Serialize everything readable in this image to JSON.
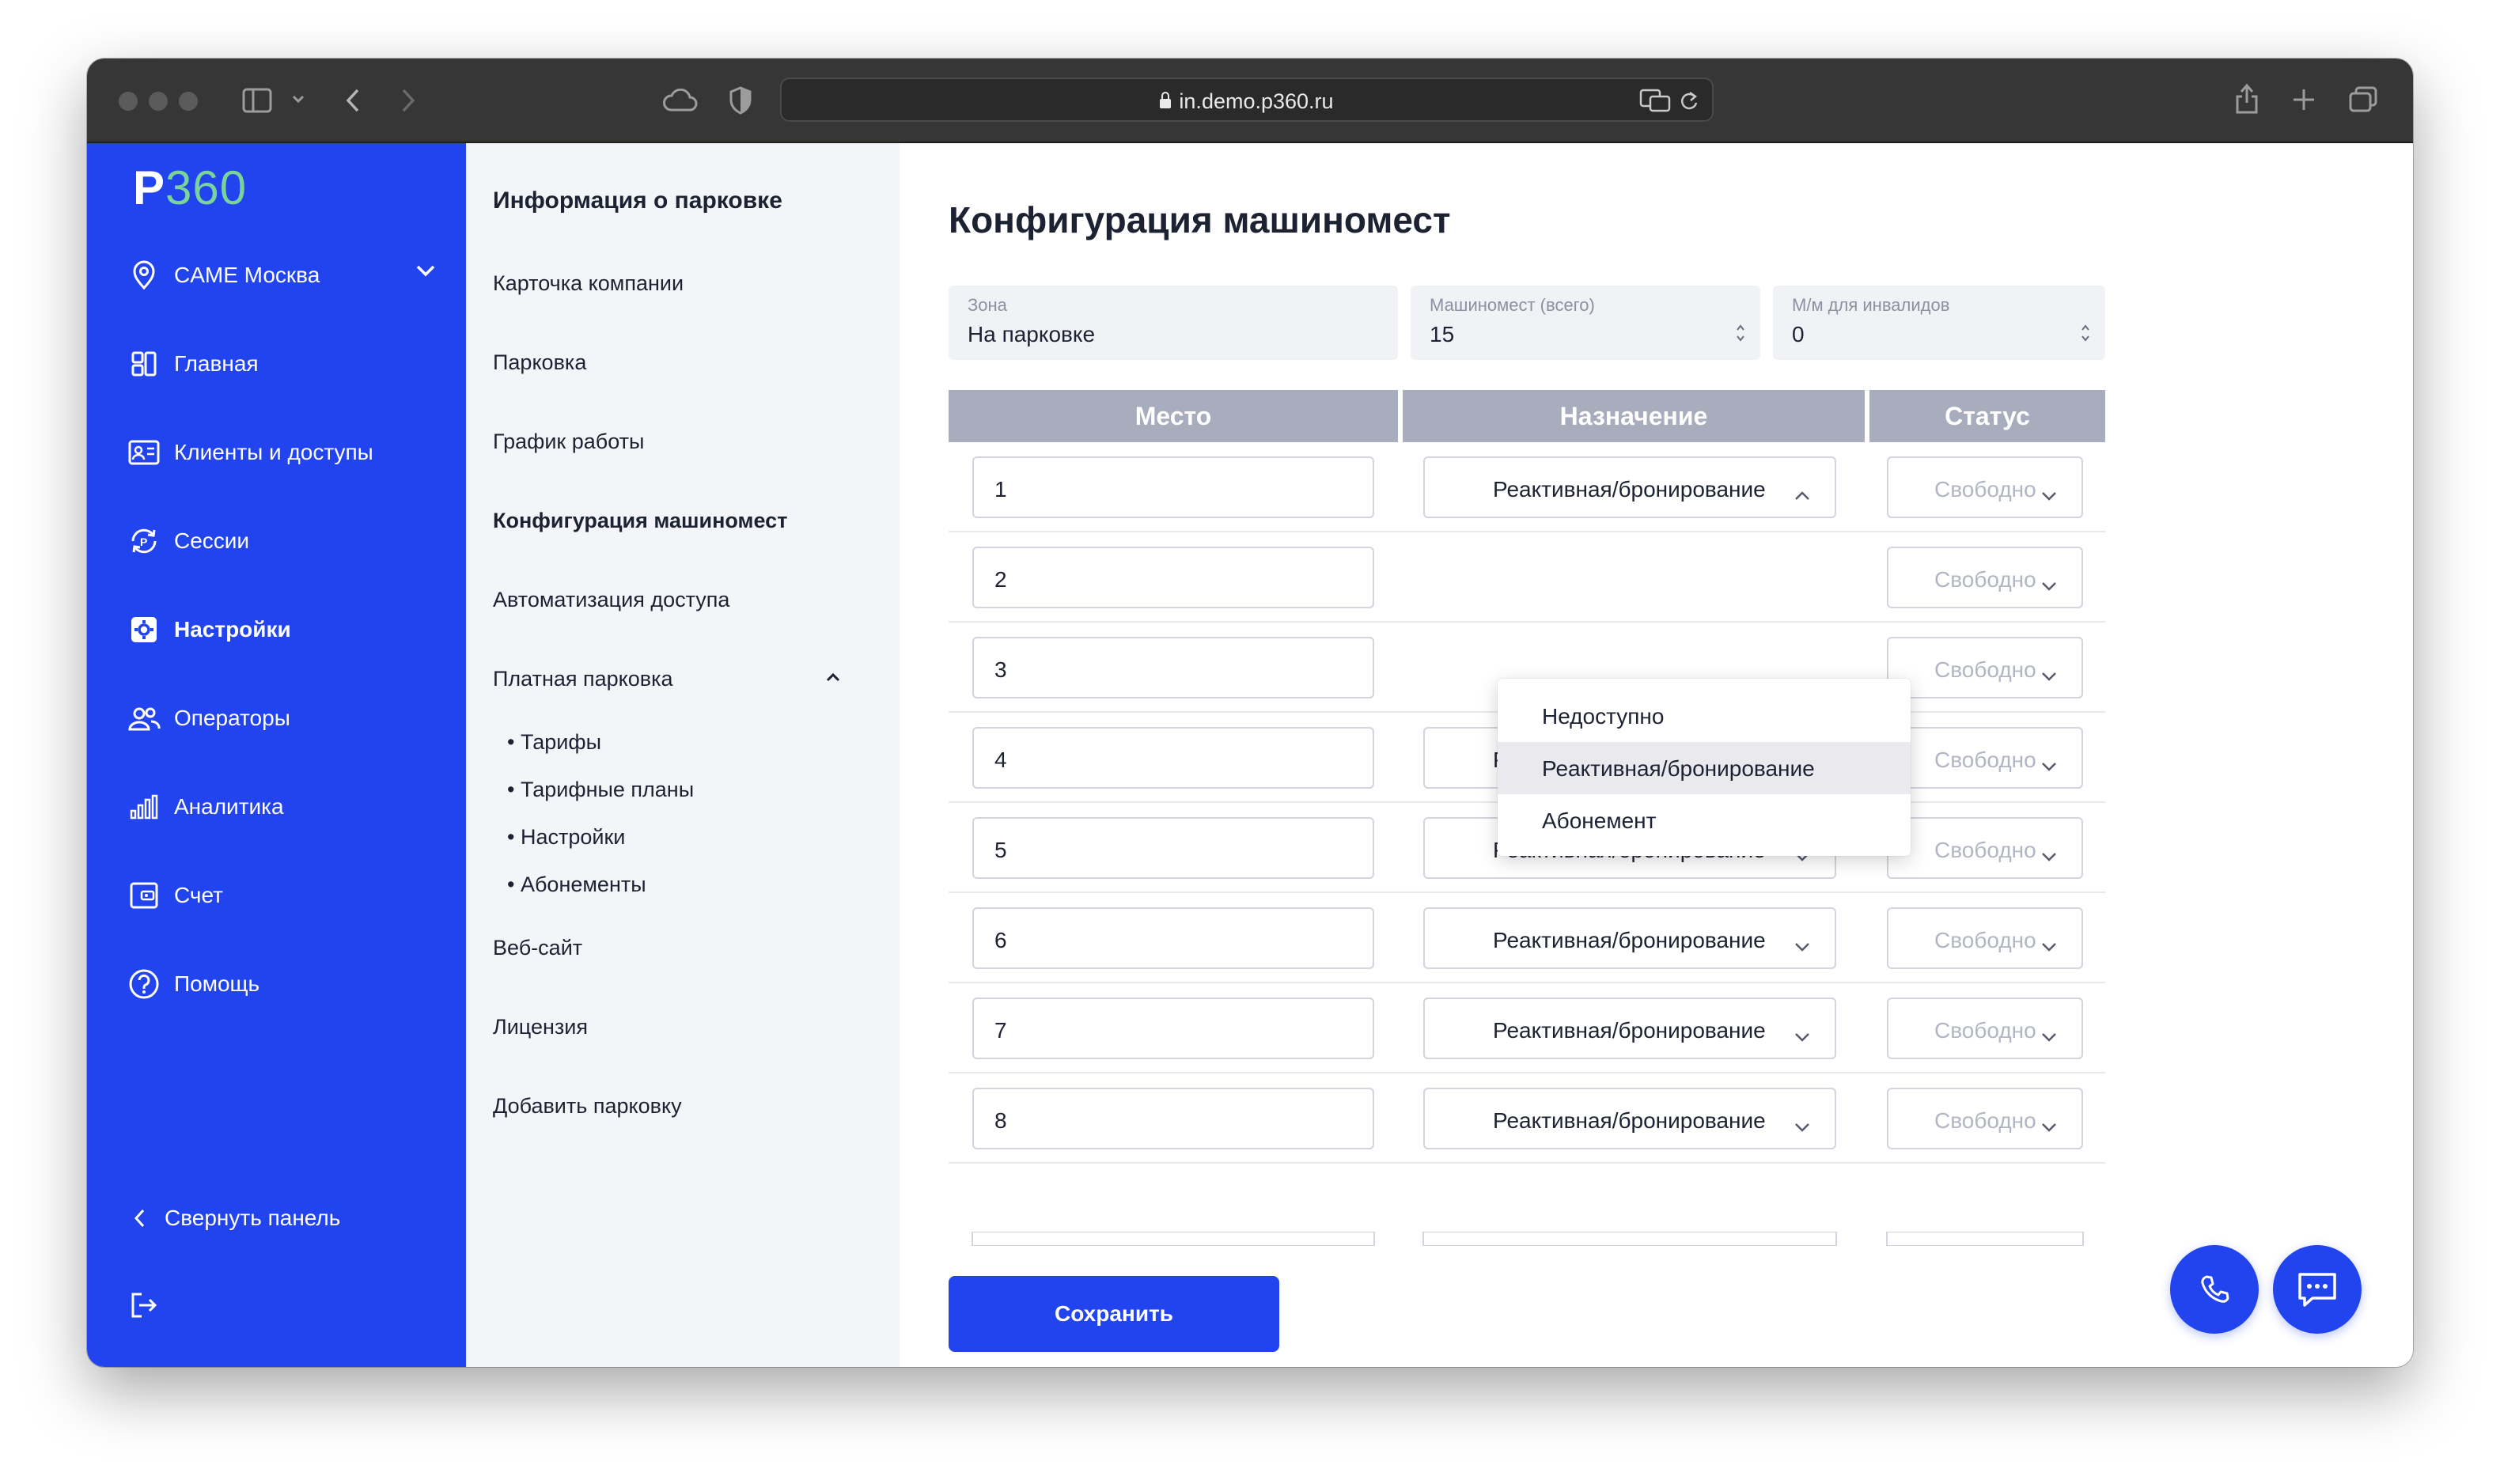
{
  "browser": {
    "url": "in.demo.p360.ru"
  },
  "sidebar": {
    "logo_p": "P",
    "logo_n": "360",
    "org": "CAME Москва",
    "items": [
      {
        "label": "Главная"
      },
      {
        "label": "Клиенты и доступы"
      },
      {
        "label": "Сессии"
      },
      {
        "label": "Настройки"
      },
      {
        "label": "Операторы"
      },
      {
        "label": "Аналитика"
      },
      {
        "label": "Счет"
      },
      {
        "label": "Помощь"
      }
    ],
    "collapse": "Свернуть панель"
  },
  "settings": {
    "title": "Информация о парковке",
    "items": [
      "Карточка компании",
      "Парковка",
      "График работы",
      "Конфигурация машиномест",
      "Автоматизация доступа",
      "Платная парковка",
      "Веб-сайт",
      "Лицензия",
      "Добавить парковку"
    ],
    "paid_sub": [
      "• Тарифы",
      "• Тарифные планы",
      "• Настройки",
      "• Абонементы"
    ]
  },
  "main": {
    "title": "Конфигурация машиномест",
    "fields": {
      "zone_label": "Зона",
      "zone_value": "На парковке",
      "total_label": "Машиномест (всего)",
      "total_value": "15",
      "disabled_label": "М/м для инвалидов",
      "disabled_value": "0"
    },
    "columns": [
      "Место",
      "Назначение",
      "Статус"
    ],
    "rows": [
      {
        "place": "1",
        "purpose": "Реактивная/бронирование",
        "status": "Свободно"
      },
      {
        "place": "2",
        "purpose": "",
        "status": "Свободно"
      },
      {
        "place": "3",
        "purpose": "",
        "status": "Свободно"
      },
      {
        "place": "4",
        "purpose": "Реактивная/бронирование",
        "status": "Свободно"
      },
      {
        "place": "5",
        "purpose": "Реактивная/бронирование",
        "status": "Свободно"
      },
      {
        "place": "6",
        "purpose": "Реактивная/бронирование",
        "status": "Свободно"
      },
      {
        "place": "7",
        "purpose": "Реактивная/бронирование",
        "status": "Свободно"
      },
      {
        "place": "8",
        "purpose": "Реактивная/бронирование",
        "status": "Свободно"
      }
    ],
    "dropdown": [
      "Недоступно",
      "Реактивная/бронирование",
      "Абонемент"
    ],
    "save": "Сохранить"
  },
  "colors": {
    "accent": "#2244ef",
    "table_header": "#a7adbc"
  }
}
